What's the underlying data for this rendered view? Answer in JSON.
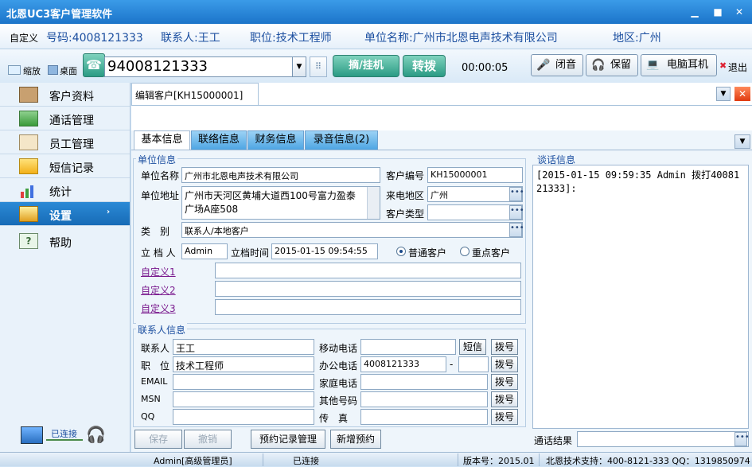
{
  "window": {
    "title": "北恩UC3客户管理软件"
  },
  "infobar": {
    "custom": "自定义",
    "number": "号码:4008121333",
    "contact": "联系人:王工",
    "position": "职位:技术工程师",
    "company": "单位名称:广州市北恩电声技术有限公司",
    "region": "地区:广州"
  },
  "toolbar": {
    "shrink": "缩放",
    "desktop": "桌面",
    "dial_value": "94008121333",
    "pickup_hangup": "摘/挂机",
    "transfer": "转拨",
    "timer": "00:00:05",
    "mute": "闭音",
    "hold": "保留",
    "pc_headset": "电脑耳机",
    "exit": "退出"
  },
  "sidebar": {
    "items": [
      {
        "label": "客户资料"
      },
      {
        "label": "通话管理"
      },
      {
        "label": "员工管理"
      },
      {
        "label": "短信记录"
      },
      {
        "label": "统计"
      },
      {
        "label": "设置"
      },
      {
        "label": "帮助"
      }
    ],
    "connected": "已连接"
  },
  "doc_tab": {
    "title": "编辑客户[KH15000001]"
  },
  "tabs": [
    {
      "label": "基本信息"
    },
    {
      "label": "联络信息"
    },
    {
      "label": "财务信息"
    },
    {
      "label": "录音信息(2)"
    }
  ],
  "unit": {
    "title": "单位信息",
    "name_label": "单位名称",
    "name_value": "广州市北恩电声技术有限公司",
    "code_label": "客户编号",
    "code_value": "KH15000001",
    "addr_label": "单位地址",
    "addr_value": "广州市天河区黄埔大道西100号富力盈泰广场A座508",
    "area_label": "来电地区",
    "area_value": "广州",
    "type_label": "客户类型",
    "type_value": "",
    "category_label": "类　别",
    "category_value": "联系人/本地客户",
    "creator_label": "立 档 人",
    "creator_value": "Admin",
    "time_label": "立档时间",
    "time_value": "2015-01-15 09:54:55",
    "radio_normal": "普通客户",
    "radio_key": "重点客户",
    "custom1": "自定义1",
    "custom2": "自定义2",
    "custom3": "自定义3"
  },
  "contact": {
    "title": "联系人信息",
    "name_label": "联系人",
    "name_value": "王工",
    "pos_label": "职　位",
    "pos_value": "技术工程师",
    "email_label": "EMAIL",
    "msn_label": "MSN",
    "qq_label": "QQ",
    "mobile_label": "移动电话",
    "office_label": "办公电话",
    "office_value": "4008121333",
    "home_label": "家庭电话",
    "other_label": "其他号码",
    "fax_label": "传　真",
    "sms": "短信",
    "dial": "拨号",
    "dash": "-"
  },
  "actions": {
    "save": "保存",
    "cancel": "撤销",
    "appointment_mgmt": "预约记录管理",
    "new_appointment": "新增预约"
  },
  "talk": {
    "title": "谈话信息",
    "content": "[2015-01-15 09:59:35 Admin 拨打4008121333]:",
    "result_label": "通话结果"
  },
  "status": {
    "user": "Admin[高级管理员]",
    "state": "已连接",
    "version": "版本号：2015.01",
    "support": "北恩技术支持：400-8121-333 QQ：1319850974"
  },
  "colors": {
    "title_blue": "#1b74c9",
    "accent_green": "#2b9b84",
    "link_purple": "#7a1a8e"
  }
}
